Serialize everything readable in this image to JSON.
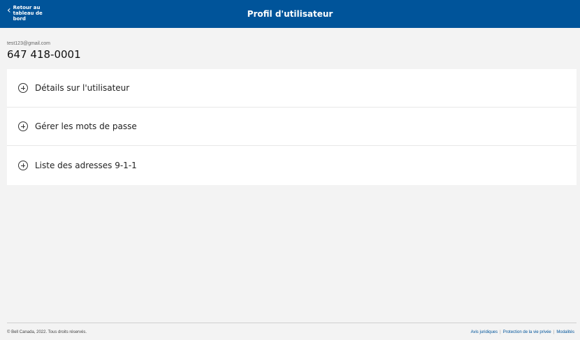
{
  "header": {
    "back_label": "Retour au tableau de bord",
    "title": "Profil d'utilisateur"
  },
  "user": {
    "email": "test123@gmail.com",
    "phone": "647 418-0001"
  },
  "sections": [
    {
      "label": "Détails sur l'utilisateur",
      "icon": "plus-circle-icon"
    },
    {
      "label": "Gérer les mots de passe",
      "icon": "plus-circle-icon"
    },
    {
      "label": "Liste des adresses 9-1-1",
      "icon": "plus-circle-icon"
    }
  ],
  "footer": {
    "copyright": "© Bell Canada, 2022. Tous droits réservés.",
    "links": [
      "Avis juridiques",
      "Protection de la vie privée",
      "Modalités"
    ]
  },
  "colors": {
    "brand": "#00549a",
    "background": "#f3f3f3"
  }
}
